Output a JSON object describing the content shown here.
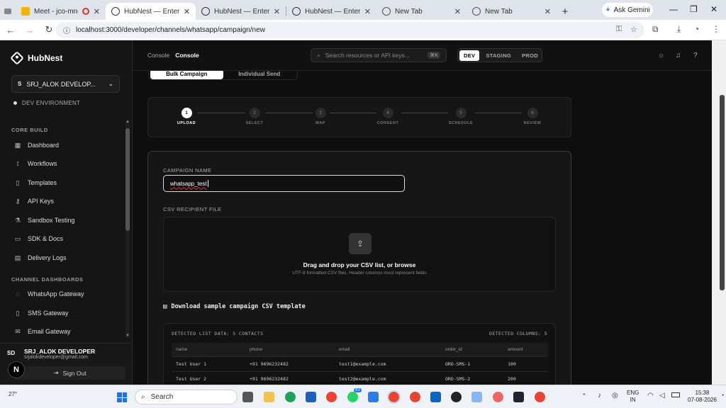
{
  "browser": {
    "tabs": [
      {
        "title": "Meet - jco-mnoe",
        "active": false
      },
      {
        "title": "HubNest — Enterprise",
        "active": true
      },
      {
        "title": "HubNest — Enterprise",
        "active": false
      },
      {
        "title": "HubNest — Enterprise",
        "active": false
      },
      {
        "title": "New Tab",
        "active": false
      },
      {
        "title": "New Tab",
        "active": false
      }
    ],
    "gemini": "Ask Gemini",
    "url": "localhost:3000/developer/channels/whatsapp/campaign/new"
  },
  "sidebar": {
    "brand": "HubNest",
    "org_badge": "S",
    "org_name": "SRJ_ALOK DEVELOP...",
    "env": "DEV ENVIRONMENT",
    "core_title": "CORE BUILD",
    "core_items": [
      {
        "label": "Dashboard"
      },
      {
        "label": "Workflows"
      },
      {
        "label": "Templates"
      },
      {
        "label": "API Keys"
      },
      {
        "label": "Sandbox Testing"
      },
      {
        "label": "SDK & Docs"
      },
      {
        "label": "Delivery Logs"
      }
    ],
    "channel_title": "CHANNEL DASHBOARDS",
    "channel_items": [
      {
        "label": "WhatsApp Gateway"
      },
      {
        "label": "SMS Gateway"
      },
      {
        "label": "Email Gateway"
      }
    ],
    "user_initials": "SD",
    "user_name": "SRJ_ALOK DEVELOPER",
    "user_email": "srjalokdeveloper@gmail.com",
    "sign_out": "Sign Out",
    "n_badge": "N"
  },
  "header": {
    "crumb_parent": "Console",
    "crumb_current": "Console",
    "search_placeholder": "Search resources or API keys...",
    "search_kbd": "⌘K",
    "envs": [
      "DEV",
      "STAGING",
      "PROD"
    ],
    "active_env": "DEV"
  },
  "main": {
    "tabs": [
      "Bulk Campaign",
      "Individual Send"
    ],
    "steps": [
      {
        "num": "1",
        "label": "UPLOAD"
      },
      {
        "num": "2",
        "label": "SELECT"
      },
      {
        "num": "3",
        "label": "MAP"
      },
      {
        "num": "4",
        "label": "CONSENT"
      },
      {
        "num": "5",
        "label": "SCHEDULE"
      },
      {
        "num": "6",
        "label": "REVIEW"
      }
    ],
    "campaign_label": "CAMPAIGN NAME",
    "campaign_value": "whatsapp_test",
    "csv_label": "CSV RECIPIENT FILE",
    "drop_title": "Drag and drop your CSV list, or browse",
    "drop_sub": "UTF-8 formatted CSV files. Header columns must represent fields",
    "download_link": "Download sample campaign CSV template",
    "detected_list": "DETECTED LIST DATA: 5 CONTACTS",
    "detected_cols": "DETECTED COLUMNS: 5",
    "table": {
      "headers": [
        "name",
        "phone",
        "email",
        "order_id",
        "amount"
      ],
      "rows": [
        [
          "Test User 1",
          "+91 9696232482",
          "test1@example.com",
          "ORD-SMS-1",
          "100"
        ],
        [
          "Test User 2",
          "+91 9696232482",
          "test2@example.com",
          "ORD-SMS-2",
          "200"
        ]
      ]
    }
  },
  "taskbar": {
    "weather": "27°",
    "search": "Search",
    "whatsapp_badge": "83",
    "lang1": "ENG",
    "lang2": "IN",
    "time": "15:38",
    "date": "07-08-2026"
  }
}
